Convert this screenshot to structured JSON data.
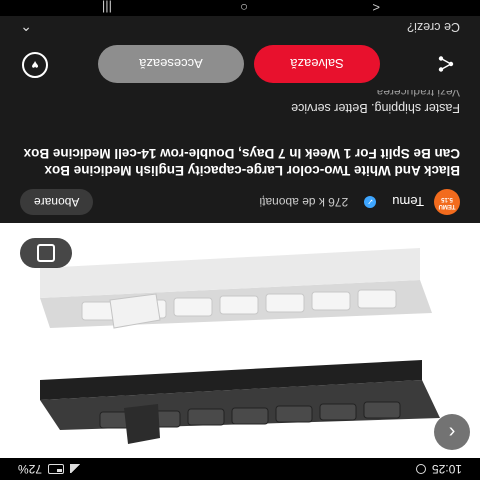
{
  "status": {
    "time": "10:25",
    "battery": "72%"
  },
  "media": {
    "back_icon": "chevron-left-icon",
    "lens_icon": "lens-icon"
  },
  "channel": {
    "name": "Temu",
    "subscribers": "276 k de abonați",
    "avatar_text": "TEMU 5.15",
    "subscribe_label": "Abonare"
  },
  "video": {
    "title": "Black And White Two-color Large-capacity English Medicine Box Can Be Split For 1 Week In 7 Days, Double-row 14-cell Medicine Box",
    "subtitle": "Faster shipping. Better service",
    "translate_label": "Vezi traducerea"
  },
  "actions": {
    "save_label": "Salvează",
    "access_label": "Accesează",
    "share_icon": "share-icon",
    "like_icon": "heart-icon"
  },
  "question": {
    "label": "Ce crezi?"
  },
  "nav": {
    "back": "<",
    "home": "○",
    "recents": "|||"
  },
  "colors": {
    "save": "#e8112d",
    "access": "#8e8e8e",
    "brand": "#f26b1d"
  }
}
